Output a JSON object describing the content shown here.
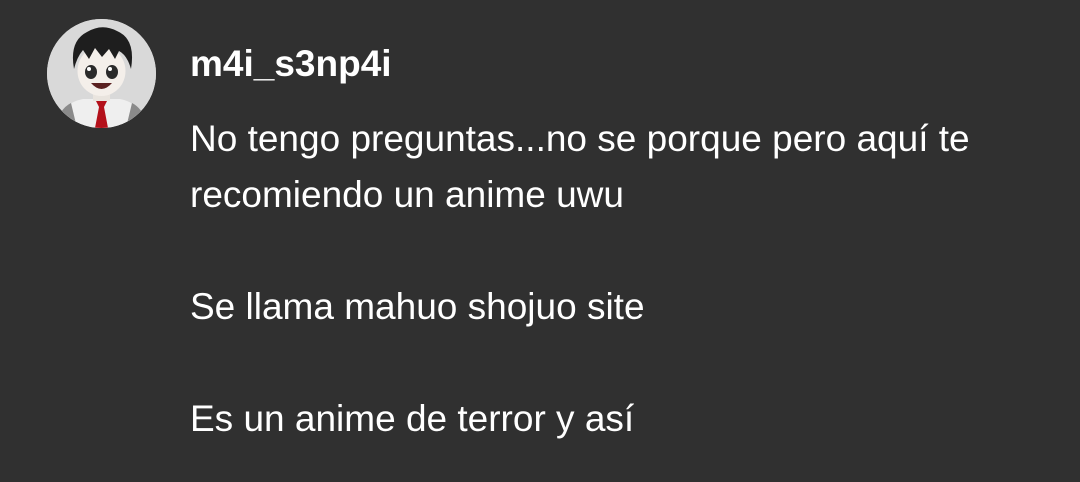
{
  "comment": {
    "username": "m4i_s3np4i",
    "avatar_icon": "anime-character-avatar-icon",
    "paragraphs": [
      "No tengo preguntas...no se porque pero aquí te recomiendo un anime uwu",
      "Se llama mahuo shojuo site",
      "Es un anime de terror y así"
    ]
  },
  "colors": {
    "background": "#303030",
    "text": "#ffffff"
  }
}
